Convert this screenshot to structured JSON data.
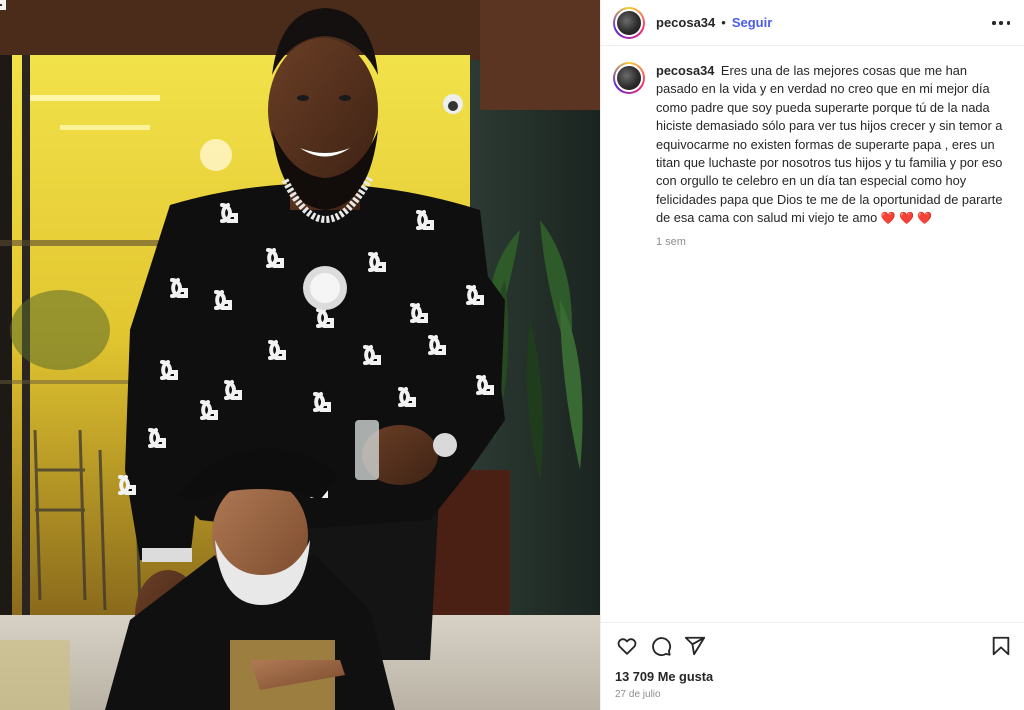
{
  "post": {
    "username": "pecosa34",
    "separator": "•",
    "follow_label": "Seguir",
    "more_icon": "more-options-icon"
  },
  "caption": {
    "username": "pecosa34",
    "text": "Eres una de las mejores cosas que me han pasado en la vida y en verdad no creo que en mi mejor día como padre que soy pueda superarte porque tú de la nada hiciste demasiado sólo para ver tus hijos crecer y sin temor a equivocarme no existen formas de superarte papa , eres un titan que luchaste por nosotros tus hijos y tu familia y por eso con orgullo te celebro en un día tan especial como hoy felicidades papa que Dios te me de la oportunidad de pararte de esa cama con salud mi viejo te amo",
    "hearts": "❤️ ❤️ ❤️",
    "timestamp": "1 sem"
  },
  "actions": {
    "like_icon": "heart-icon",
    "comment_icon": "comment-icon",
    "share_icon": "share-icon",
    "save_icon": "bookmark-icon",
    "likes": "13 709 Me gusta",
    "date": "27 de julio"
  },
  "colors": {
    "follow": "#4a5de8",
    "text": "#262626",
    "muted": "#8e8e8e",
    "heart": "#e0245e"
  }
}
